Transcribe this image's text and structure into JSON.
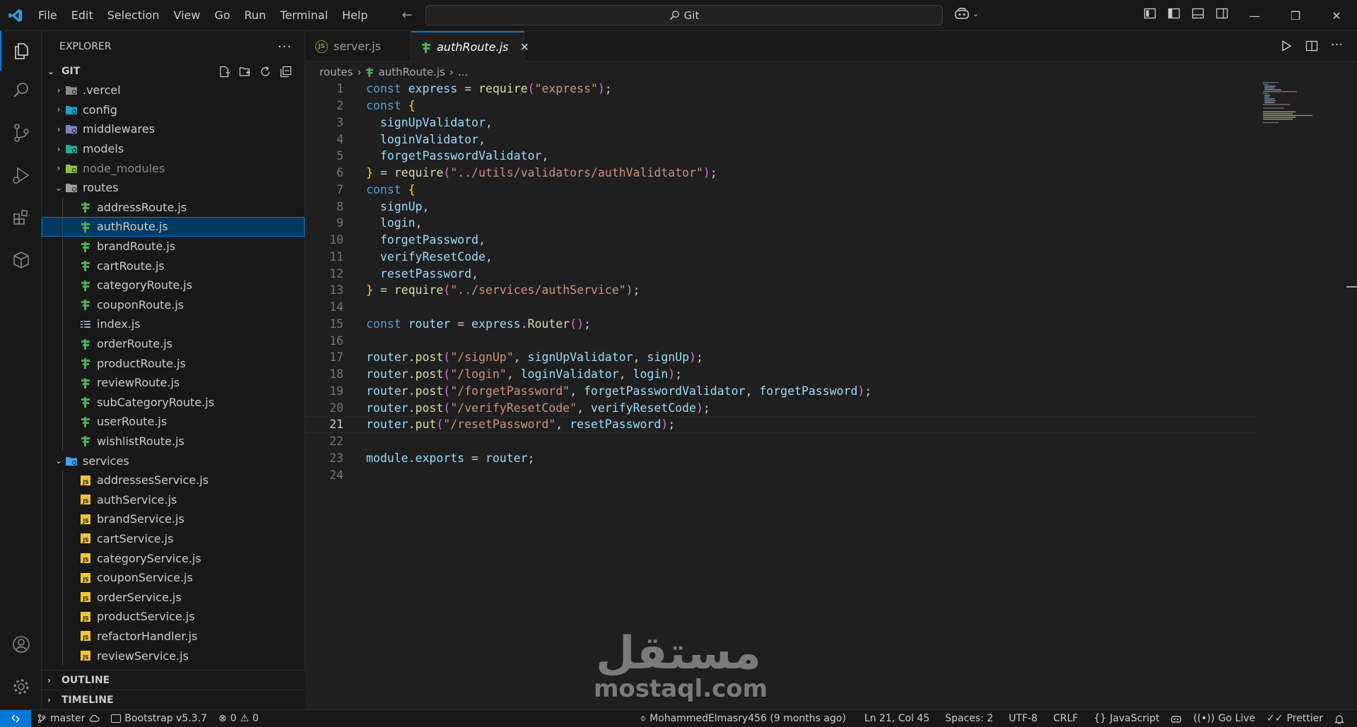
{
  "menu": [
    "File",
    "Edit",
    "Selection",
    "View",
    "Go",
    "Run",
    "Terminal",
    "Help"
  ],
  "command_center": "Git",
  "explorer": {
    "title": "EXPLORER",
    "folder": "GIT",
    "items": [
      {
        "label": ".vercel",
        "type": "folder",
        "icon": "folder-vercel-icon",
        "dim": false
      },
      {
        "label": "config",
        "type": "folder",
        "icon": "folder-config-icon",
        "dim": false
      },
      {
        "label": "middlewares",
        "type": "folder",
        "icon": "folder-middleware-icon",
        "dim": false
      },
      {
        "label": "models",
        "type": "folder",
        "icon": "folder-models-icon",
        "dim": false
      },
      {
        "label": "node_modules",
        "type": "folder",
        "icon": "folder-node-icon",
        "dim": true
      },
      {
        "label": "routes",
        "type": "folder-open",
        "icon": "folder-routes-icon",
        "dim": false
      },
      {
        "label": "addressRoute.js",
        "type": "route",
        "icon": "route-file-icon"
      },
      {
        "label": "authRoute.js",
        "type": "route",
        "icon": "route-file-icon",
        "selected": true
      },
      {
        "label": "brandRoute.js",
        "type": "route",
        "icon": "route-file-icon"
      },
      {
        "label": "cartRoute.js",
        "type": "route",
        "icon": "route-file-icon"
      },
      {
        "label": "categoryRoute.js",
        "type": "route",
        "icon": "route-file-icon"
      },
      {
        "label": "couponRoute.js",
        "type": "route",
        "icon": "route-file-icon"
      },
      {
        "label": "index.js",
        "type": "index",
        "icon": "list-file-icon"
      },
      {
        "label": "orderRoute.js",
        "type": "route",
        "icon": "route-file-icon"
      },
      {
        "label": "productRoute.js",
        "type": "route",
        "icon": "route-file-icon"
      },
      {
        "label": "reviewRoute.js",
        "type": "route",
        "icon": "route-file-icon"
      },
      {
        "label": "subCategoryRoute.js",
        "type": "route",
        "icon": "route-file-icon"
      },
      {
        "label": "userRoute.js",
        "type": "route",
        "icon": "route-file-icon"
      },
      {
        "label": "wishlistRoute.js",
        "type": "route",
        "icon": "route-file-icon"
      },
      {
        "label": "services",
        "type": "folder-open",
        "icon": "folder-services-icon"
      },
      {
        "label": "addressesService.js",
        "type": "js",
        "icon": "js-file-icon"
      },
      {
        "label": "authService.js",
        "type": "js",
        "icon": "js-file-icon"
      },
      {
        "label": "brandService.js",
        "type": "js",
        "icon": "js-file-icon"
      },
      {
        "label": "cartService.js",
        "type": "js",
        "icon": "js-file-icon"
      },
      {
        "label": "categoryService.js",
        "type": "js",
        "icon": "js-file-icon"
      },
      {
        "label": "couponService.js",
        "type": "js",
        "icon": "js-file-icon"
      },
      {
        "label": "orderService.js",
        "type": "js",
        "icon": "js-file-icon"
      },
      {
        "label": "productService.js",
        "type": "js",
        "icon": "js-file-icon"
      },
      {
        "label": "refactorHandler.js",
        "type": "js",
        "icon": "js-file-icon"
      },
      {
        "label": "reviewService.js",
        "type": "js",
        "icon": "js-file-icon"
      }
    ],
    "outline": "OUTLINE",
    "timeline": "TIMELINE"
  },
  "tabs": [
    {
      "label": "server.js",
      "active": false
    },
    {
      "label": "authRoute.js",
      "active": true
    }
  ],
  "breadcrumb": {
    "folder": "routes",
    "file": "authRoute.js",
    "more": "..."
  },
  "code_lines": [
    "const express = require(\"express\");",
    "const {",
    "  signUpValidator,",
    "  loginValidator,",
    "  forgetPasswordValidator,",
    "} = require(\"../utils/validators/authValidtator\");",
    "const {",
    "  signUp,",
    "  login,",
    "  forgetPassword,",
    "  verifyResetCode,",
    "  resetPassword,",
    "} = require(\"../services/authService\");",
    "",
    "const router = express.Router();",
    "",
    "router.post(\"/signUp\", signUpValidator, signUp);",
    "router.post(\"/login\", loginValidator, login);",
    "router.post(\"/forgetPassword\", forgetPasswordValidator, forgetPassword);",
    "router.post(\"/verifyResetCode\", verifyResetCode);",
    "router.put(\"/resetPassword\", resetPassword);",
    "",
    "module.exports = router;",
    ""
  ],
  "current_line": 21,
  "watermark": {
    "arabic": "مستقل",
    "latin": "mostaql.com"
  },
  "status": {
    "branch": "master",
    "bootstrap": "Bootstrap v5.3.7",
    "errors": "0",
    "warnings": "0",
    "blame": "MohammedElmasry456 (9 months ago)",
    "position": "Ln 21, Col 45",
    "spaces": "Spaces: 2",
    "encoding": "UTF-8",
    "eol": "CRLF",
    "language": "JavaScript",
    "golive": "Go Live",
    "prettier": "Prettier"
  },
  "colors": {
    "accent": "#0078d4",
    "route_icon": "#4caf50",
    "js_icon": "#f0c43a"
  }
}
